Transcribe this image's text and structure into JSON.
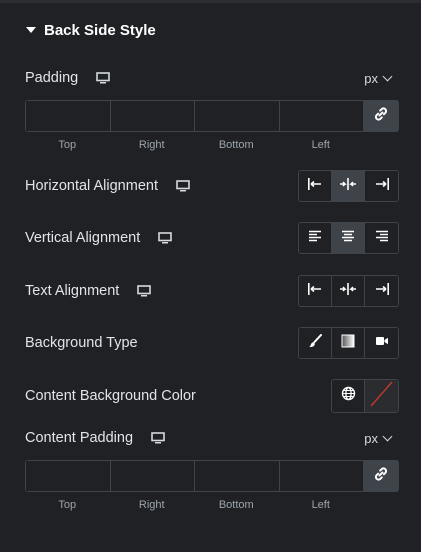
{
  "section": {
    "title": "Back Side Style",
    "caret_icon": "caret-down-icon"
  },
  "padding": {
    "label": "Padding",
    "unit": "px",
    "fields": {
      "top": "",
      "right": "",
      "bottom": "",
      "left": ""
    },
    "sublabels": [
      "Top",
      "Right",
      "Bottom",
      "Left"
    ],
    "link_icon": "link-icon"
  },
  "horizontal_alignment": {
    "label": "Horizontal Alignment",
    "options": [
      "align-left-icon",
      "align-center-icon",
      "align-right-icon"
    ],
    "selected": 1
  },
  "vertical_alignment": {
    "label": "Vertical Alignment",
    "options": [
      "text-left-icon",
      "text-center-icon",
      "text-right-icon"
    ],
    "selected": 1
  },
  "text_alignment": {
    "label": "Text Alignment",
    "options": [
      "align-left-icon",
      "align-center-icon",
      "align-right-icon"
    ],
    "selected": null
  },
  "background_type": {
    "label": "Background Type",
    "options": [
      "brush-icon",
      "gradient-icon",
      "video-icon"
    ],
    "selected": null
  },
  "content_background_color": {
    "label": "Content Background Color",
    "globe_icon": "globe-icon",
    "swatch": "none",
    "swatch_slash_color": "#c0392b"
  },
  "content_padding": {
    "label": "Content Padding",
    "unit": "px",
    "fields": {
      "top": "",
      "right": "",
      "bottom": "",
      "left": ""
    },
    "sublabels": [
      "Top",
      "Right",
      "Bottom",
      "Left"
    ],
    "link_icon": "link-icon"
  },
  "colors": {
    "panel_bg": "#1f2124",
    "border": "#3f444b",
    "active_bg": "#3f444b",
    "text": "#d5dadf"
  }
}
